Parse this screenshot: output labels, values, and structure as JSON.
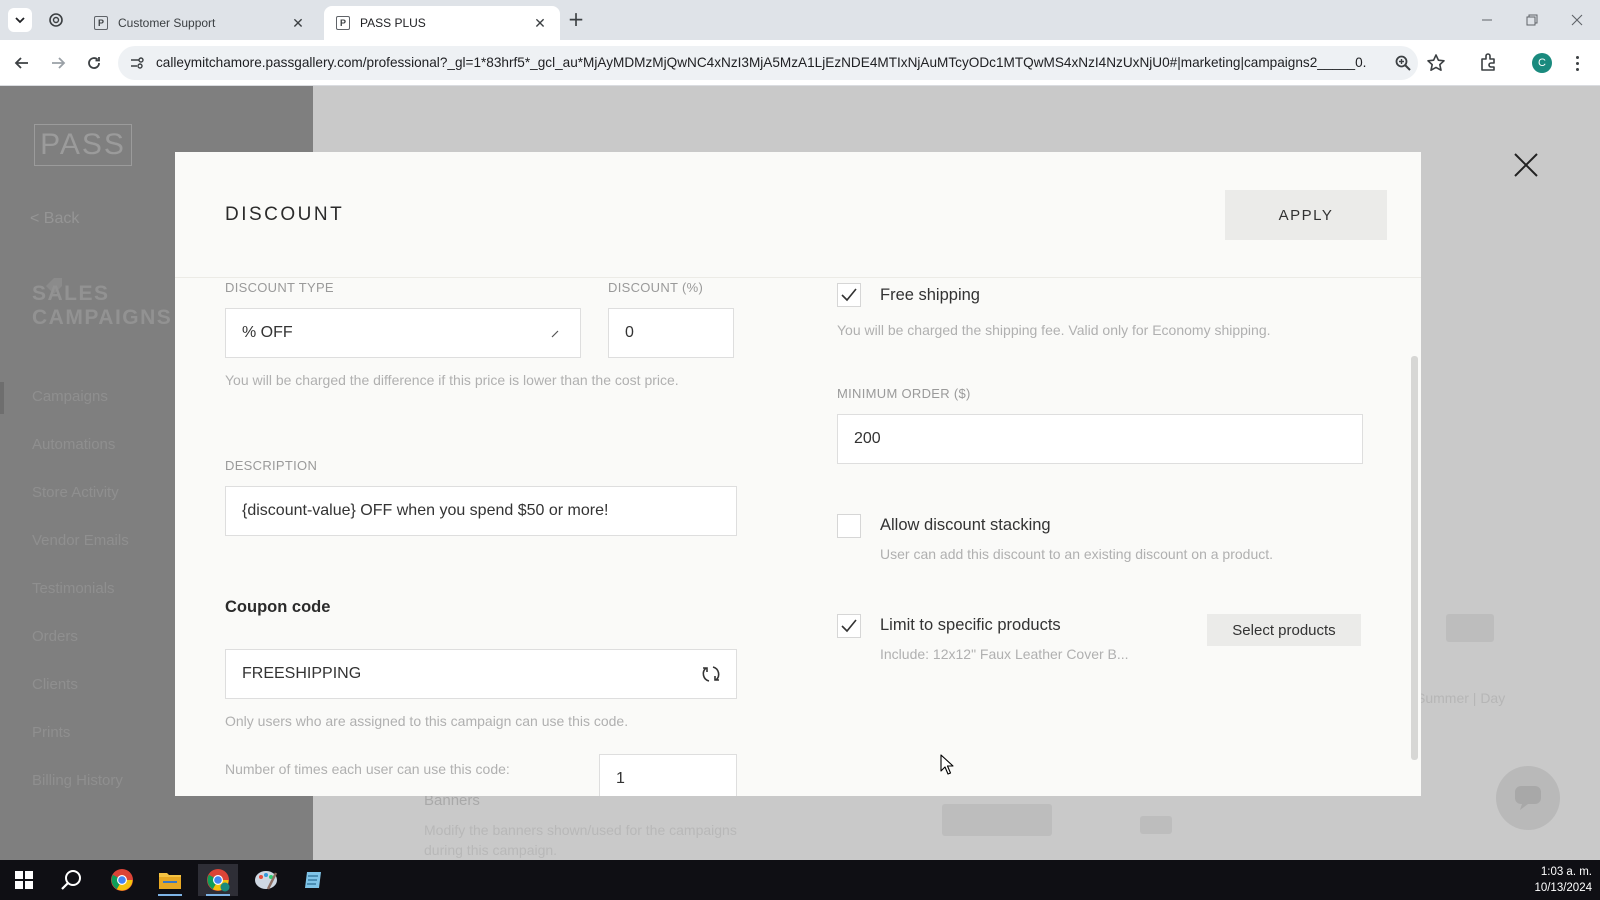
{
  "browser": {
    "tabs": [
      {
        "title": "Customer Support",
        "favicon": "P",
        "active": false
      },
      {
        "title": "PASS PLUS",
        "favicon": "P",
        "active": true
      }
    ],
    "url": "calleymitchamore.passgallery.com/professional?_gl=1*83hrf5*_gcl_au*MjAyMDMzMjQwNC4xNzI3MjA5MzA1LjEzNDE4MTIxNjAuMTcyODc1MTQwMS4xNzI4NzUxNjU0#|marketing|campaigns2_____0...",
    "profile_initial": "C"
  },
  "background_app": {
    "logo": "PASS",
    "back_label": "< Back",
    "section_title": "SALES CAMPAIGNS",
    "sidebar_items": [
      "Campaigns",
      "Automations",
      "Store Activity",
      "Vendor Emails",
      "Testimonials",
      "Orders",
      "Clients",
      "Prints",
      "Billing History"
    ],
    "footer_title": "Banners",
    "footer_text": "Modify the banners shown/used for the campaigns during this campaign.",
    "right_text": "Summer | Day"
  },
  "modal": {
    "title": "DISCOUNT",
    "apply_label": "APPLY",
    "discount_type": {
      "label": "DISCOUNT TYPE",
      "value": "% OFF"
    },
    "discount_percent": {
      "label": "DISCOUNT (%)",
      "value": "0"
    },
    "price_hint": "You will be charged the difference if this price is lower than the cost price.",
    "description": {
      "label": "DESCRIPTION",
      "value": "{discount-value} OFF when you spend $50 or more!"
    },
    "coupon": {
      "heading": "Coupon code",
      "value": "FREESHIPPING",
      "hint": "Only users who are assigned to this campaign can use this code.",
      "uses_label": "Number of times each user can use this code:",
      "uses_value": "1"
    },
    "free_shipping": {
      "label": "Free shipping",
      "checked": true,
      "hint": "You will be charged the shipping fee. Valid only for Economy shipping."
    },
    "minimum_order": {
      "label": "MINIMUM ORDER ($)",
      "value": "200"
    },
    "stacking": {
      "label": "Allow discount stacking",
      "checked": false,
      "hint": "User can add this discount to an existing discount on a product."
    },
    "limit_products": {
      "label": "Limit to specific products",
      "checked": true,
      "hint": "Include: 12x12\" Faux Leather Cover B...",
      "button": "Select products"
    }
  },
  "taskbar": {
    "time": "1:03 a. m.",
    "date": "10/13/2024"
  },
  "colors": {
    "overlay": "#c9c9c9",
    "modal_bg": "#fafaf8",
    "button_bg": "#ebebe9",
    "taskbar": "#0f0f14"
  }
}
